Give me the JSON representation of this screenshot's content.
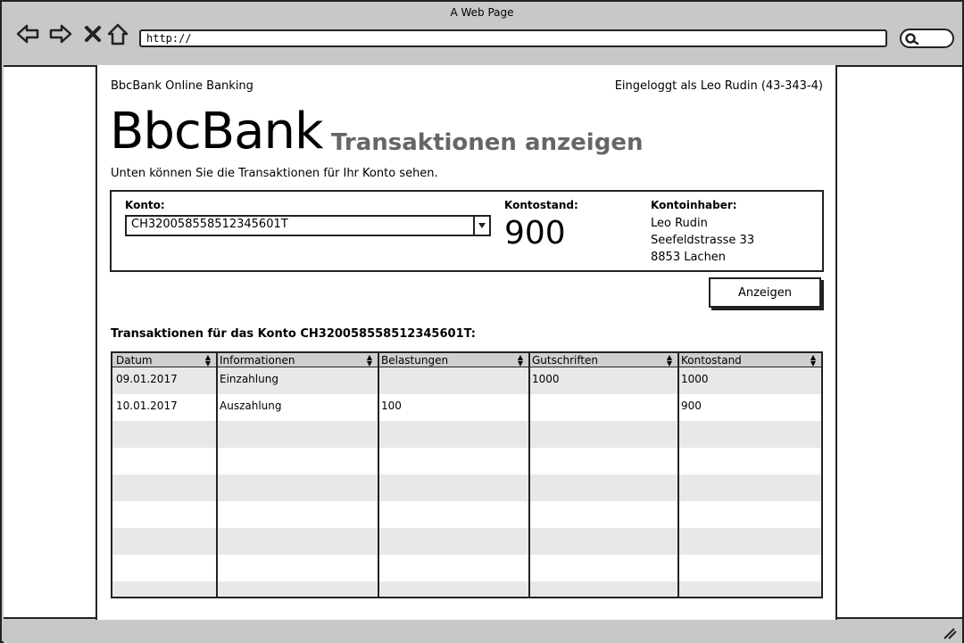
{
  "browser": {
    "window_title": "A Web Page",
    "url": "http://"
  },
  "page": {
    "site_name": "BbcBank Online Banking",
    "login_info": "Eingeloggt als Leo Rudin (43-343-4)",
    "logo": "BbcBank",
    "heading": "Transaktionen anzeigen",
    "intro": "Unten können Sie die Transaktionen für Ihr Konto sehen."
  },
  "account": {
    "konto_label": "Konto:",
    "konto_value": "CH320058558512345601T",
    "balance_label": "Kontostand:",
    "balance_value": "900",
    "holder_label": "Kontoinhaber:",
    "holder_name": "Leo Rudin",
    "holder_street": "Seefeldstrasse 33",
    "holder_city": "8853 Lachen"
  },
  "show_button": "Anzeigen",
  "transactions": {
    "title": "Transaktionen für das Konto CH320058558512345601T:",
    "columns": [
      "Datum",
      "Informationen",
      "Belastungen",
      "Gutschriften",
      "Kontostand"
    ],
    "rows": [
      [
        "09.01.2017",
        "Einzahlung",
        "",
        "1000",
        "1000"
      ],
      [
        "10.01.2017",
        "Auszahlung",
        "100",
        "",
        "900"
      ],
      [
        "",
        "",
        "",
        "",
        ""
      ],
      [
        "",
        "",
        "",
        "",
        ""
      ],
      [
        "",
        "",
        "",
        "",
        ""
      ],
      [
        "",
        "",
        "",
        "",
        ""
      ],
      [
        "",
        "",
        "",
        "",
        ""
      ],
      [
        "",
        "",
        "",
        "",
        ""
      ],
      [
        "",
        "",
        "",
        "",
        ""
      ]
    ]
  }
}
